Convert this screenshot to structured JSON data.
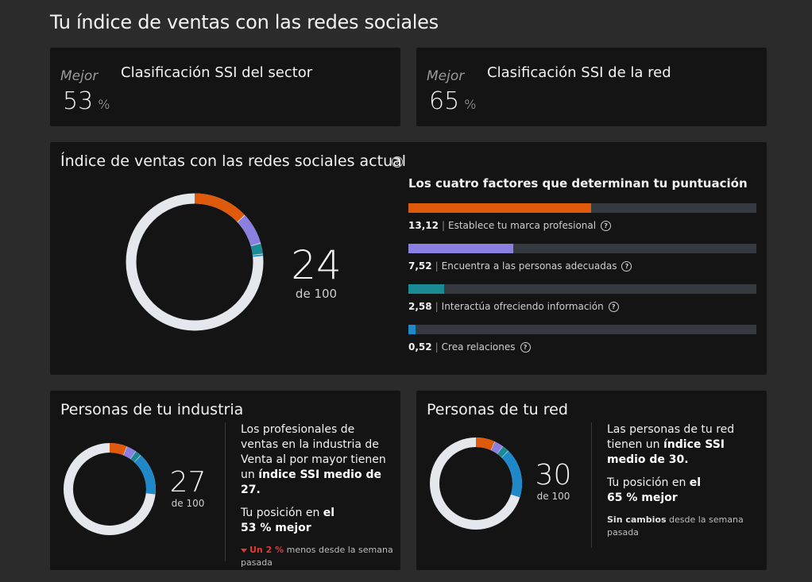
{
  "page": {
    "title": "Tu índice de ventas con las redes sociales"
  },
  "colors": {
    "brand": "#e05a0c",
    "people": "#8b7fe0",
    "engage": "#1a8a95",
    "relations": "#1e88c9",
    "track": "#343a40",
    "ring": "#e4e8ed",
    "negative": "#e53935"
  },
  "sector_rank": {
    "best_label": "Mejor",
    "value": "53",
    "unit": "%",
    "label": "Clasificación SSI del sector"
  },
  "network_rank": {
    "best_label": "Mejor",
    "value": "65",
    "unit": "%",
    "label": "Clasificación SSI de la red"
  },
  "current": {
    "title": "Índice de ventas con las redes sociales actual",
    "help_icon": "question-circle-icon",
    "score": "24",
    "of": "de 100",
    "factors_heading": "Los cuatro factores que determinan tu puntuación",
    "factors": [
      {
        "value": "13,12",
        "label": "Establece tu marca profesional",
        "fraction": 0.5248,
        "color": "#e05a0c"
      },
      {
        "value": "7,52",
        "label": "Encuentra a las personas adecuadas",
        "fraction": 0.3008,
        "color": "#8b7fe0"
      },
      {
        "value": "2,58",
        "label": "Interactúa ofreciendo información",
        "fraction": 0.1032,
        "color": "#1a8a95"
      },
      {
        "value": "0,52",
        "label": "Crea relaciones",
        "fraction": 0.0208,
        "color": "#1e88c9"
      }
    ]
  },
  "industry": {
    "title": "Personas de tu industria",
    "score": "27",
    "of": "de 100",
    "segments": [
      6.2,
      3.5,
      2.2,
      15.1
    ],
    "desc_prefix": "Los profesionales de ventas en la industria de Venta al por mayor tienen un ",
    "desc_bold": "índice SSI medio de 27.",
    "position_prefix": "Tu posición en ",
    "position_bold_1": "el",
    "position_bold_2": "53 % mejor",
    "change_value": "Un 2 %",
    "change_rest": " menos desde la semana pasada"
  },
  "peers": {
    "title": "Personas de tu red",
    "score": "30",
    "of": "de 100",
    "segments": [
      6.8,
      3.2,
      2.5,
      17.5
    ],
    "desc_prefix": "Las personas de tu red tienen un ",
    "desc_bold": "índice SSI medio de 30.",
    "position_prefix": "Tu posición en ",
    "position_bold_1": "el",
    "position_bold_2": "65 % mejor",
    "change_value": "Sin cambios",
    "change_rest": " desde la semana pasada"
  }
}
